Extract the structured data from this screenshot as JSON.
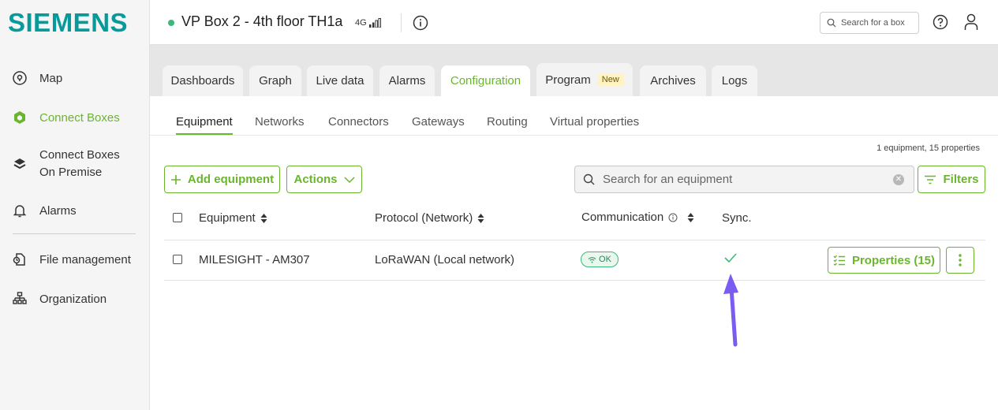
{
  "brand": {
    "logo_text": "SIEMENS"
  },
  "sidebar": {
    "items": [
      {
        "label": "Map",
        "icon": "map-pin-icon"
      },
      {
        "label": "Connect Boxes",
        "icon": "connect-box-icon"
      },
      {
        "label": "Connect Boxes On Premise",
        "line1": "Connect Boxes",
        "line2": "On Premise",
        "icon": "stack-icon"
      },
      {
        "label": "Alarms",
        "icon": "bell-icon"
      },
      {
        "label": "File management",
        "icon": "file-icon"
      },
      {
        "label": "Organization",
        "icon": "org-chart-icon"
      }
    ],
    "active": "Connect Boxes"
  },
  "header": {
    "box_title": "VP Box 2 - 4th floor TH1a",
    "network": "4G",
    "search_placeholder": "Search for a box"
  },
  "tabs": [
    {
      "label": "Dashboards"
    },
    {
      "label": "Graph"
    },
    {
      "label": "Live data"
    },
    {
      "label": "Alarms"
    },
    {
      "label": "Configuration",
      "active": true
    },
    {
      "label": "Program",
      "badge": "New"
    },
    {
      "label": "Archives"
    },
    {
      "label": "Logs"
    }
  ],
  "subtabs": [
    {
      "label": "Equipment",
      "active": true
    },
    {
      "label": "Networks"
    },
    {
      "label": "Connectors"
    },
    {
      "label": "Gateways"
    },
    {
      "label": "Routing"
    },
    {
      "label": "Virtual properties"
    }
  ],
  "summary": "1 equipment, 15 properties",
  "toolbar": {
    "add_label": "Add equipment",
    "actions_label": "Actions",
    "search_placeholder": "Search for an equipment",
    "filters_label": "Filters"
  },
  "table": {
    "columns": [
      "Equipment",
      "Protocol (Network)",
      "Communication",
      "Sync."
    ],
    "rows": [
      {
        "equipment": "MILESIGHT - AM307",
        "protocol": "LoRaWAN (Local network)",
        "communication": "OK",
        "properties_label": "Properties (15)"
      }
    ]
  },
  "colors": {
    "accent": "#6bb52e",
    "brand": "#089a9a",
    "status_ok": "#3cb878",
    "annotation": "#7b5cf0"
  }
}
